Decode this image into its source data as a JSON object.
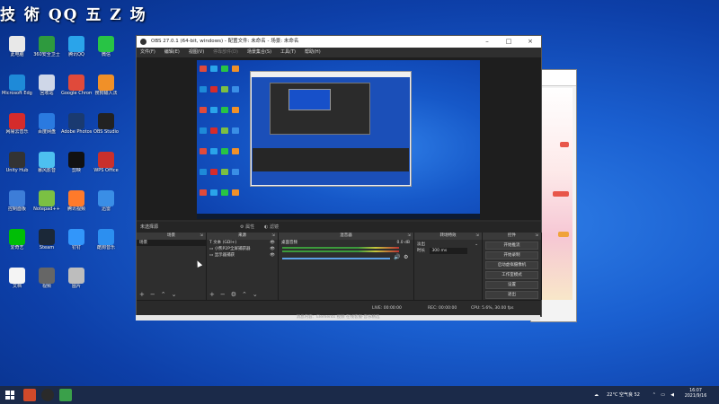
{
  "watermark": "技 術 QQ 五 Z 场",
  "desktop_icons": [
    {
      "label": "此电脑",
      "color": "#e8e8e8"
    },
    {
      "label": "360安全卫士",
      "color": "#2e9a3e"
    },
    {
      "label": "腾讯QQ",
      "color": "#2aa4ea"
    },
    {
      "label": "微信",
      "color": "#28c445"
    },
    {
      "label": "Microsoft Edge",
      "color": "#1e8ad8"
    },
    {
      "label": "回收站",
      "color": "#cfd7e8"
    },
    {
      "label": "Google Chrome",
      "color": "#e04a3b"
    },
    {
      "label": "搜狗输入法",
      "color": "#f09028"
    },
    {
      "label": "网易云音乐",
      "color": "#d52b2b"
    },
    {
      "label": "百度网盘",
      "color": "#2a7ae0"
    },
    {
      "label": "Adobe Photoshop",
      "color": "#1a3a70"
    },
    {
      "label": "OBS Studio",
      "color": "#222222"
    },
    {
      "label": "Unity Hub",
      "color": "#333333"
    },
    {
      "label": "暴风影音",
      "color": "#4dc0f0"
    },
    {
      "label": "剪映",
      "color": "#111111"
    },
    {
      "label": "WPS Office",
      "color": "#c9302c"
    },
    {
      "label": "控制面板",
      "color": "#3d7dd8"
    },
    {
      "label": "Notepad++",
      "color": "#7bc043"
    },
    {
      "label": "腾讯视频",
      "color": "#ff7a2a"
    },
    {
      "label": "迅雷",
      "color": "#3a8ee6"
    },
    {
      "label": "爱奇艺",
      "color": "#00be06"
    },
    {
      "label": "Steam",
      "color": "#1b2838"
    },
    {
      "label": "钉钉",
      "color": "#3296fa"
    },
    {
      "label": "酷狗音乐",
      "color": "#2c8ff0"
    },
    {
      "label": "文档",
      "color": "#f4f4f4"
    },
    {
      "label": "视频",
      "color": "#666666"
    },
    {
      "label": "图片",
      "color": "#bdbdbd"
    }
  ],
  "obs": {
    "title": "OBS 27.0.1 (64-bit, windows) - 配置文件: 未命名 - 场景: 未命名",
    "menu": [
      {
        "label": "文件(F)",
        "dim": false
      },
      {
        "label": "编辑(E)",
        "dim": false
      },
      {
        "label": "视图(V)",
        "dim": false
      },
      {
        "label": "停靠部件(D)",
        "dim": true
      },
      {
        "label": "场景集合(S)",
        "dim": false
      },
      {
        "label": "工具(T)",
        "dim": false
      },
      {
        "label": "帮助(H)",
        "dim": false
      }
    ],
    "scenes_bar": {
      "title": "未选择源",
      "props": "属性",
      "filters": "滤镜"
    },
    "scenes": {
      "header": "场景",
      "items": [
        "场景"
      ]
    },
    "sources": {
      "header": "来源",
      "items": [
        "文本 (GDI+)",
        "小熊P2P全屏捕获器",
        "显示器捕获"
      ]
    },
    "mixer": {
      "header": "混音器",
      "track_name": "桌面音频",
      "db": "0.0 dB"
    },
    "transitions": {
      "header": "转场特效",
      "type": "淡出",
      "duration_label": "时长",
      "duration": "300 ms"
    },
    "controls": {
      "header": "控件",
      "buttons": [
        "开始推流",
        "开始录制",
        "启动虚拟摄像机",
        "工作室模式",
        "设置",
        "退出"
      ]
    },
    "status": {
      "live": "LIVE: 00:00:00",
      "rec": "REC: 00:00:00",
      "cpu": "CPU: 5.6%, 30.00 fps"
    },
    "bottom_text": "消息内容：Elements 视频  在线客服·音乐精选"
  },
  "taskbar": {
    "weather": "22°C 空气良 52",
    "time": "16:07",
    "date": "2021/9/16"
  },
  "colors": {
    "accent": "#1a5fd0",
    "obs_bg": "#2b2b2b",
    "taskbar": "#1b2a49"
  }
}
